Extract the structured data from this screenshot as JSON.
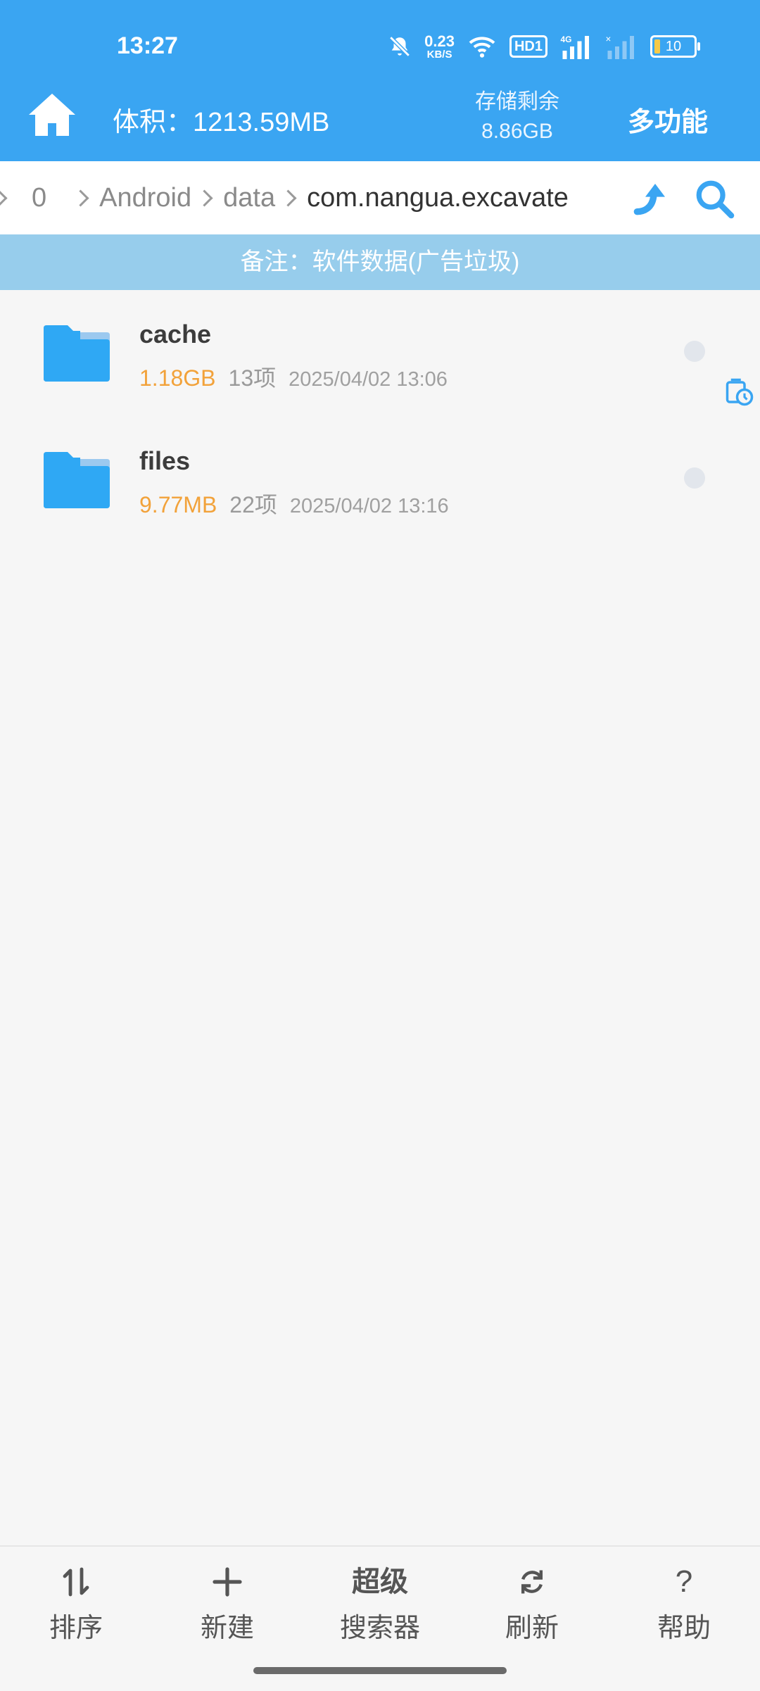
{
  "status_bar": {
    "time": "13:27",
    "net_speed_value": "0.23",
    "net_speed_unit": "KB/S",
    "hd_badge": "HD1",
    "signal_label": "4G",
    "battery": "10",
    "icons": [
      "bell-muted-icon",
      "wifi-icon",
      "signal-icon",
      "signal-weak-icon",
      "battery-icon"
    ]
  },
  "header": {
    "volume": "体积：1213.59MB",
    "storage_label": "存储剩余",
    "storage_value": "8.86GB",
    "multi_function": "多功能",
    "accent": "#3aa5f2"
  },
  "breadcrumb": {
    "items": [
      "0",
      "Android",
      "data",
      "com.nangua.excavate"
    ]
  },
  "note": "备注：软件数据(广告垃圾)",
  "files": [
    {
      "name": "cache",
      "size": "1.18GB",
      "count": "13项",
      "date": "2025/04/02 13:06"
    },
    {
      "name": "files",
      "size": "9.77MB",
      "count": "22项",
      "date": "2025/04/02 13:16"
    }
  ],
  "toolbar": {
    "sort": "排序",
    "new": "新建",
    "super_line1": "超级",
    "super_line2": "搜索器",
    "refresh": "刷新",
    "help": "帮助"
  }
}
